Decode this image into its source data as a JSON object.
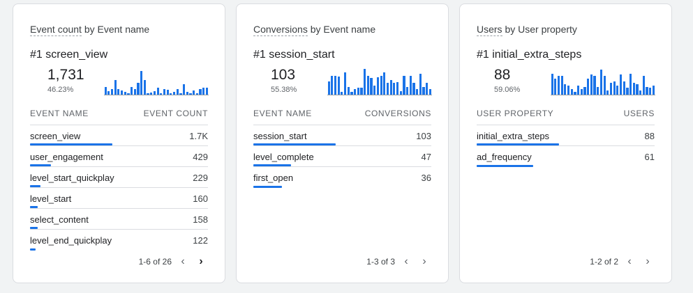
{
  "colors": {
    "accent": "#1a73e8",
    "background": "#f1f3f4",
    "card": "#ffffff"
  },
  "cards": [
    {
      "title_prefix": "Event count",
      "title_suffix": " by Event name",
      "top_label": "#1  screen_view",
      "top_value": "1,731",
      "top_pct": "46.23%",
      "spark": [
        0.3,
        0.12,
        0.22,
        0.55,
        0.2,
        0.17,
        0.1,
        0.06,
        0.28,
        0.2,
        0.45,
        0.9,
        0.55,
        0.05,
        0.08,
        0.12,
        0.25,
        0.05,
        0.22,
        0.18,
        0.05,
        0.1,
        0.2,
        0.05,
        0.4,
        0.1,
        0.05,
        0.16,
        0.05,
        0.22,
        0.25,
        0.27
      ],
      "col_left": "EVENT NAME",
      "col_right": "EVENT COUNT",
      "rows": [
        {
          "name": "screen_view",
          "value": "1.7K",
          "pct": 1.0
        },
        {
          "name": "user_engagement",
          "value": "429",
          "pct": 0.25
        },
        {
          "name": "level_start_quickplay",
          "value": "229",
          "pct": 0.13
        },
        {
          "name": "level_start",
          "value": "160",
          "pct": 0.09
        },
        {
          "name": "select_content",
          "value": "158",
          "pct": 0.09
        },
        {
          "name": "level_end_quickplay",
          "value": "122",
          "pct": 0.07
        }
      ],
      "pager_text": "1-6 of 26",
      "prev_icon": "chevron-left-icon",
      "next_icon": "chevron-right-icon",
      "prev_enabled": false,
      "next_enabled": true
    },
    {
      "title_prefix": "Conversions",
      "title_suffix": " by Event name",
      "top_label": "#1  session_start",
      "top_value": "103",
      "top_pct": "55.38%",
      "spark": [
        0.5,
        0.72,
        0.7,
        0.68,
        0.1,
        0.85,
        0.3,
        0.1,
        0.2,
        0.25,
        0.25,
        0.98,
        0.7,
        0.62,
        0.35,
        0.65,
        0.7,
        0.83,
        0.45,
        0.55,
        0.45,
        0.48,
        0.12,
        0.72,
        0.3,
        0.7,
        0.45,
        0.2,
        0.8,
        0.3,
        0.45,
        0.2
      ],
      "col_left": "EVENT NAME",
      "col_right": "CONVERSIONS",
      "rows": [
        {
          "name": "session_start",
          "value": "103",
          "pct": 1.0
        },
        {
          "name": "level_complete",
          "value": "47",
          "pct": 0.46
        },
        {
          "name": "first_open",
          "value": "36",
          "pct": 0.35
        }
      ],
      "pager_text": "1-3 of 3",
      "prev_icon": "chevron-left-icon",
      "next_icon": "chevron-right-icon",
      "prev_enabled": false,
      "next_enabled": false
    },
    {
      "title_prefix": "Users",
      "title_suffix": " by User property",
      "top_label": "#1  initial_extra_steps",
      "top_value": "88",
      "top_pct": "59.06%",
      "spark": [
        0.8,
        0.6,
        0.7,
        0.72,
        0.4,
        0.35,
        0.2,
        0.1,
        0.35,
        0.2,
        0.3,
        0.6,
        0.75,
        0.7,
        0.3,
        0.95,
        0.7,
        0.15,
        0.45,
        0.5,
        0.35,
        0.75,
        0.5,
        0.25,
        0.8,
        0.45,
        0.4,
        0.15,
        0.7,
        0.3,
        0.25,
        0.35
      ],
      "col_left": "USER PROPERTY",
      "col_right": "USERS",
      "rows": [
        {
          "name": "initial_extra_steps",
          "value": "88",
          "pct": 1.0
        },
        {
          "name": "ad_frequency",
          "value": "61",
          "pct": 0.69
        }
      ],
      "pager_text": "1-2 of 2",
      "prev_icon": "chevron-left-icon",
      "next_icon": "chevron-right-icon",
      "prev_enabled": false,
      "next_enabled": false
    }
  ]
}
